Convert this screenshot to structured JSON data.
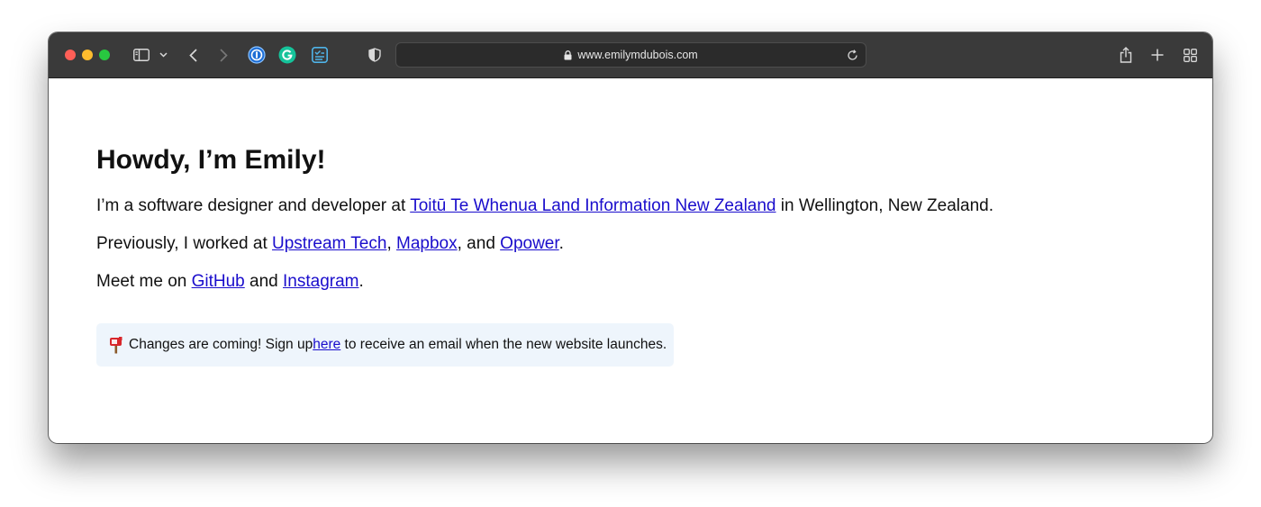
{
  "browser": {
    "url": "www.emilymdubois.com",
    "icons": {
      "sidebar": "sidebar-icon",
      "sidebar_menu": "chevron-down-icon",
      "back": "chevron-left-icon",
      "forward": "chevron-right-icon",
      "ext_1password": "onepassword-icon",
      "ext_grammarly": "grammarly-icon",
      "ext_tasks": "tasks-extension-icon",
      "privacy": "shield-icon",
      "lock": "lock-icon",
      "reload": "reload-icon",
      "share": "share-icon",
      "new_tab": "plus-icon",
      "tab_overview": "tab-overview-icon"
    }
  },
  "page": {
    "heading": "Howdy, I’m Emily!",
    "intro": {
      "before": "I’m a software designer and developer at ",
      "link": "Toitū Te Whenua Land Information New Zealand",
      "after": " in Wellington, New Zealand."
    },
    "previously": {
      "before": "Previously, I worked at ",
      "link1": "Upstream Tech",
      "sep1": ", ",
      "link2": "Mapbox",
      "sep2": ", and ",
      "link3": "Opower",
      "end": "."
    },
    "social": {
      "before": "Meet me on ",
      "link1": "GitHub",
      "sep": " and ",
      "link2": "Instagram",
      "end": "."
    },
    "notice": {
      "icon": "mailbox-icon",
      "before": "Changes are coming! Sign up ",
      "link": "here",
      "after": " to receive an email when the new website launches."
    }
  },
  "colors": {
    "link": "#1a0dcc",
    "notice_bg": "#eef5fc",
    "toolbar": "#3a3a3a"
  }
}
